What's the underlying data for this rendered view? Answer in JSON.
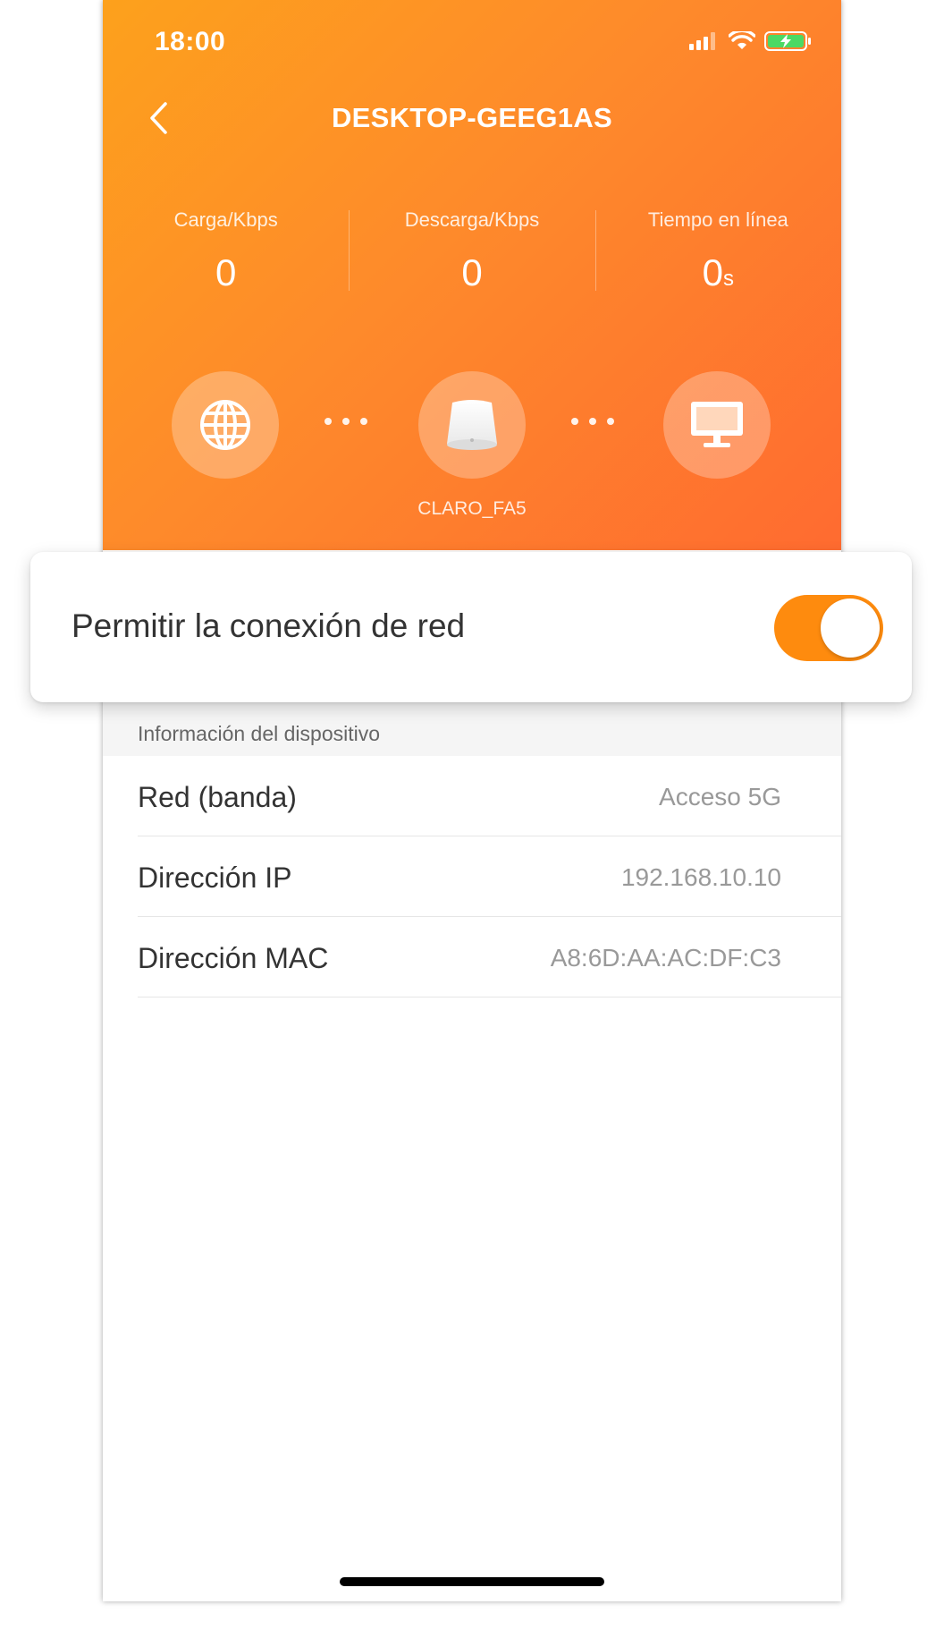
{
  "status_bar": {
    "time": "18:00",
    "icons": [
      "cellular-signal-icon",
      "wifi-icon",
      "battery-charging-icon"
    ]
  },
  "nav": {
    "title": "DESKTOP-GEEG1AS",
    "back_icon": "chevron-left-icon"
  },
  "stats": [
    {
      "label": "Carga/Kbps",
      "value": "0",
      "unit": ""
    },
    {
      "label": "Descarga/Kbps",
      "value": "0",
      "unit": ""
    },
    {
      "label": "Tiempo en línea",
      "value": "0",
      "unit": "s"
    }
  ],
  "topology": {
    "internet_icon": "globe-icon",
    "router_icon": "router-icon",
    "router_name": "CLARO_FA5",
    "device_icon": "monitor-icon"
  },
  "access": {
    "label": "Permitir la conexión de red",
    "enabled": true
  },
  "device_info": {
    "section_title": "Información del dispositivo",
    "rows": [
      {
        "key": "Red (banda)",
        "value": "Acceso 5G"
      },
      {
        "key": "Dirección IP",
        "value": "192.168.10.10"
      },
      {
        "key": "Dirección MAC",
        "value": "A8:6D:AA:AC:DF:C3"
      }
    ]
  },
  "colors": {
    "header_gradient_start": "#fda11c",
    "header_gradient_end": "#ff6b30",
    "toggle_on": "#fe8b0e",
    "battery_green": "#4cd964"
  }
}
